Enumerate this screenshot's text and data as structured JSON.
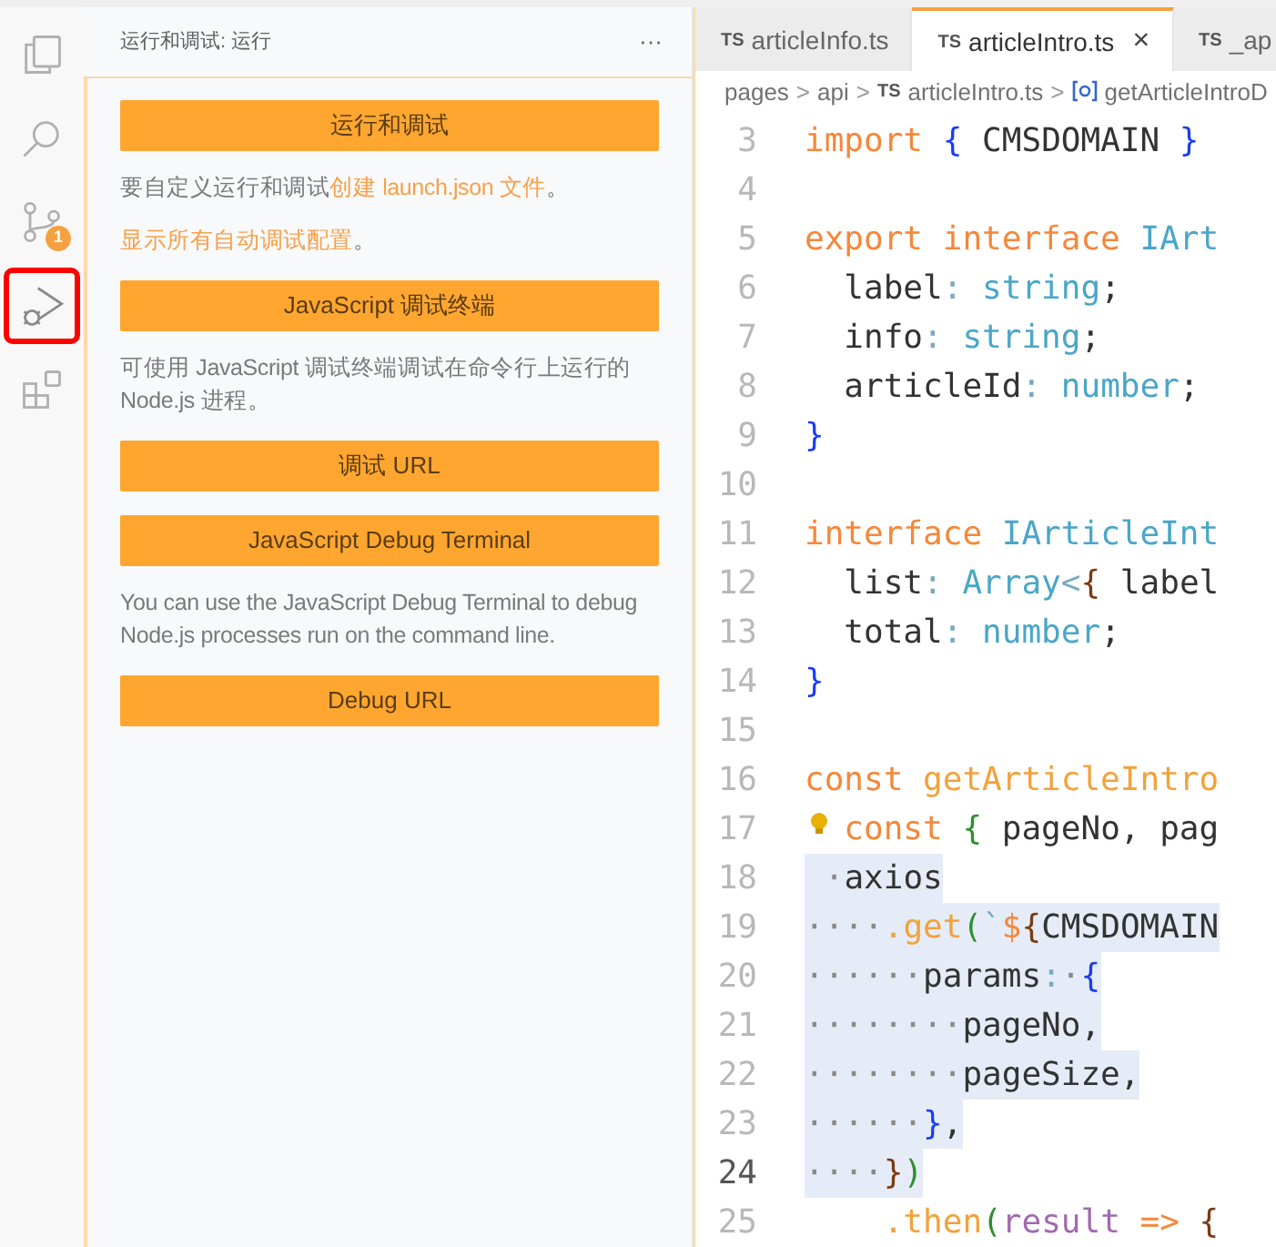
{
  "activity_bar": [
    {
      "kind": "files",
      "selected": false,
      "annotated": false
    },
    {
      "kind": "search",
      "selected": false,
      "annotated": false
    },
    {
      "kind": "source-control",
      "selected": false,
      "annotated": false,
      "badge": "1"
    },
    {
      "kind": "run-debug",
      "selected": true,
      "annotated": true
    },
    {
      "kind": "extensions",
      "selected": false,
      "annotated": false
    }
  ],
  "sidebar": {
    "title": "运行和调试: 运行",
    "more": "···",
    "content": [
      {
        "kind": "button",
        "label": "运行和调试"
      },
      {
        "kind": "paragraph",
        "parts": [
          {
            "text": "要自定义运行和调试",
            "link": false
          },
          {
            "text": "创建 launch.json 文件",
            "link": true
          },
          {
            "text": "。",
            "link": false
          }
        ]
      },
      {
        "kind": "paragraph",
        "parts": [
          {
            "text": "显示所有自动调试配置",
            "link": true
          },
          {
            "text": "。",
            "link": false
          }
        ]
      },
      {
        "kind": "button",
        "label": "JavaScript 调试终端"
      },
      {
        "kind": "paragraph",
        "parts": [
          {
            "text": "可使用 JavaScript 调试终端调试在命令行上运行的 Node.js 进程。",
            "link": false
          }
        ]
      },
      {
        "kind": "button",
        "label": "调试 URL"
      },
      {
        "kind": "button",
        "label": "JavaScript Debug Terminal"
      },
      {
        "kind": "paragraph",
        "parts": [
          {
            "text": "You can use the JavaScript Debug Terminal to debug Node.js processes run on the command line.",
            "link": false
          }
        ]
      },
      {
        "kind": "button",
        "label": "Debug URL"
      }
    ]
  },
  "tabs": [
    {
      "badge": "TS",
      "label": "articleInfo.ts",
      "selected": false
    },
    {
      "badge": "TS",
      "label": "articleIntro.ts",
      "selected": true,
      "close": "×"
    },
    {
      "badge": "TS",
      "label": "_ap",
      "selected": false
    }
  ],
  "breadcrumb": [
    {
      "kind": "text",
      "label": "pages"
    },
    {
      "kind": "sep",
      "label": ">"
    },
    {
      "kind": "text",
      "label": "api"
    },
    {
      "kind": "sep",
      "label": ">"
    },
    {
      "kind": "file",
      "badge": "TS",
      "label": "articleIntro.ts"
    },
    {
      "kind": "sep",
      "label": ">"
    },
    {
      "kind": "symbol",
      "label": "getArticleIntroD"
    }
  ],
  "code": [
    {
      "number": "3",
      "current": false,
      "selected": false,
      "tokens": [
        {
          "kind": "keyword",
          "text": "import"
        },
        {
          "kind": "brace1",
          "text": " {"
        },
        {
          "kind": "plain",
          "text": " CMSDOMAIN"
        },
        {
          "kind": "brace1",
          "text": " }"
        }
      ]
    },
    {
      "number": "4",
      "current": false,
      "selected": false
    },
    {
      "number": "5",
      "current": false,
      "selected": false,
      "tokens": [
        {
          "kind": "keyword",
          "text": "export interface"
        },
        {
          "kind": "type",
          "text": " IArt"
        }
      ]
    },
    {
      "number": "6",
      "current": false,
      "selected": false,
      "tokens": [
        {
          "kind": "plain",
          "text": "  label"
        },
        {
          "kind": "punct",
          "text": ":"
        },
        {
          "kind": "type",
          "text": " string"
        },
        {
          "kind": "plain",
          "text": ";"
        }
      ]
    },
    {
      "number": "7",
      "current": false,
      "selected": false,
      "tokens": [
        {
          "kind": "plain",
          "text": "  info"
        },
        {
          "kind": "punct",
          "text": ":"
        },
        {
          "kind": "type",
          "text": " string"
        },
        {
          "kind": "plain",
          "text": ";"
        }
      ]
    },
    {
      "number": "8",
      "current": false,
      "selected": false,
      "tokens": [
        {
          "kind": "plain",
          "text": "  articleId"
        },
        {
          "kind": "punct",
          "text": ":"
        },
        {
          "kind": "type",
          "text": " number"
        },
        {
          "kind": "plain",
          "text": ";"
        }
      ]
    },
    {
      "number": "9",
      "current": false,
      "selected": false,
      "tokens": [
        {
          "kind": "brace1",
          "text": "}"
        }
      ]
    },
    {
      "number": "10",
      "current": false,
      "selected": false
    },
    {
      "number": "11",
      "current": false,
      "selected": false,
      "tokens": [
        {
          "kind": "keyword",
          "text": "interface"
        },
        {
          "kind": "type",
          "text": " IArticleInt"
        }
      ]
    },
    {
      "number": "12",
      "current": false,
      "selected": false,
      "tokens": [
        {
          "kind": "plain",
          "text": "  list"
        },
        {
          "kind": "punct",
          "text": ":"
        },
        {
          "kind": "type",
          "text": " Array"
        },
        {
          "kind": "punct",
          "text": "<"
        },
        {
          "kind": "brace2",
          "text": "{"
        },
        {
          "kind": "plain",
          "text": " label"
        }
      ]
    },
    {
      "number": "13",
      "current": false,
      "selected": false,
      "tokens": [
        {
          "kind": "plain",
          "text": "  total"
        },
        {
          "kind": "punct",
          "text": ":"
        },
        {
          "kind": "type",
          "text": " number"
        },
        {
          "kind": "plain",
          "text": ";"
        }
      ]
    },
    {
      "number": "14",
      "current": false,
      "selected": false,
      "tokens": [
        {
          "kind": "brace1",
          "text": "}"
        }
      ]
    },
    {
      "number": "15",
      "current": false,
      "selected": false
    },
    {
      "number": "16",
      "current": false,
      "selected": false,
      "tokens": [
        {
          "kind": "keyword",
          "text": "const"
        },
        {
          "kind": "function",
          "text": " getArticleIntro"
        }
      ]
    },
    {
      "number": "17",
      "current": false,
      "selected": false,
      "lightbulb": true,
      "tokens": [
        {
          "kind": "keyword",
          "text": "const"
        },
        {
          "kind": "brace3",
          "text": " {"
        },
        {
          "kind": "plain",
          "text": " pageNo, pag"
        }
      ]
    },
    {
      "number": "18",
      "current": false,
      "selected": true,
      "tokens": [
        {
          "kind": "whitespace",
          "text": " ·"
        },
        {
          "kind": "plain",
          "text": "axios"
        }
      ]
    },
    {
      "number": "19",
      "current": false,
      "selected": true,
      "tokens": [
        {
          "kind": "whitespace",
          "text": "····"
        },
        {
          "kind": "function",
          "text": ".get"
        },
        {
          "kind": "brace3",
          "text": "("
        },
        {
          "kind": "punct",
          "text": "`"
        },
        {
          "kind": "keyword",
          "text": "$"
        },
        {
          "kind": "brace2",
          "text": "{"
        },
        {
          "kind": "plain",
          "text": "CMSDOMAIN"
        }
      ]
    },
    {
      "number": "20",
      "current": false,
      "selected": true,
      "tokens": [
        {
          "kind": "whitespace",
          "text": "······"
        },
        {
          "kind": "plain",
          "text": "params"
        },
        {
          "kind": "punct",
          "text": ":"
        },
        {
          "kind": "whitespace",
          "text": "·"
        },
        {
          "kind": "brace1",
          "text": "{"
        }
      ]
    },
    {
      "number": "21",
      "current": false,
      "selected": true,
      "tokens": [
        {
          "kind": "whitespace",
          "text": "········"
        },
        {
          "kind": "plain",
          "text": "pageNo,"
        }
      ]
    },
    {
      "number": "22",
      "current": false,
      "selected": true,
      "tokens": [
        {
          "kind": "whitespace",
          "text": "········"
        },
        {
          "kind": "plain",
          "text": "pageSize,"
        }
      ]
    },
    {
      "number": "23",
      "current": false,
      "selected": true,
      "tokens": [
        {
          "kind": "whitespace",
          "text": "······"
        },
        {
          "kind": "brace1",
          "text": "}"
        },
        {
          "kind": "plain",
          "text": ","
        }
      ]
    },
    {
      "number": "24",
      "current": true,
      "selected": true,
      "tokens": [
        {
          "kind": "whitespace",
          "text": "····"
        },
        {
          "kind": "brace2",
          "text": "}"
        },
        {
          "kind": "brace3",
          "text": ")"
        }
      ]
    },
    {
      "number": "25",
      "current": false,
      "selected": false,
      "tokens": [
        {
          "kind": "function",
          "text": "    .then"
        },
        {
          "kind": "brace3",
          "text": "("
        },
        {
          "kind": "param",
          "text": "result"
        },
        {
          "kind": "keyword",
          "text": " =>"
        },
        {
          "kind": "brace2",
          "text": " {"
        }
      ]
    }
  ]
}
